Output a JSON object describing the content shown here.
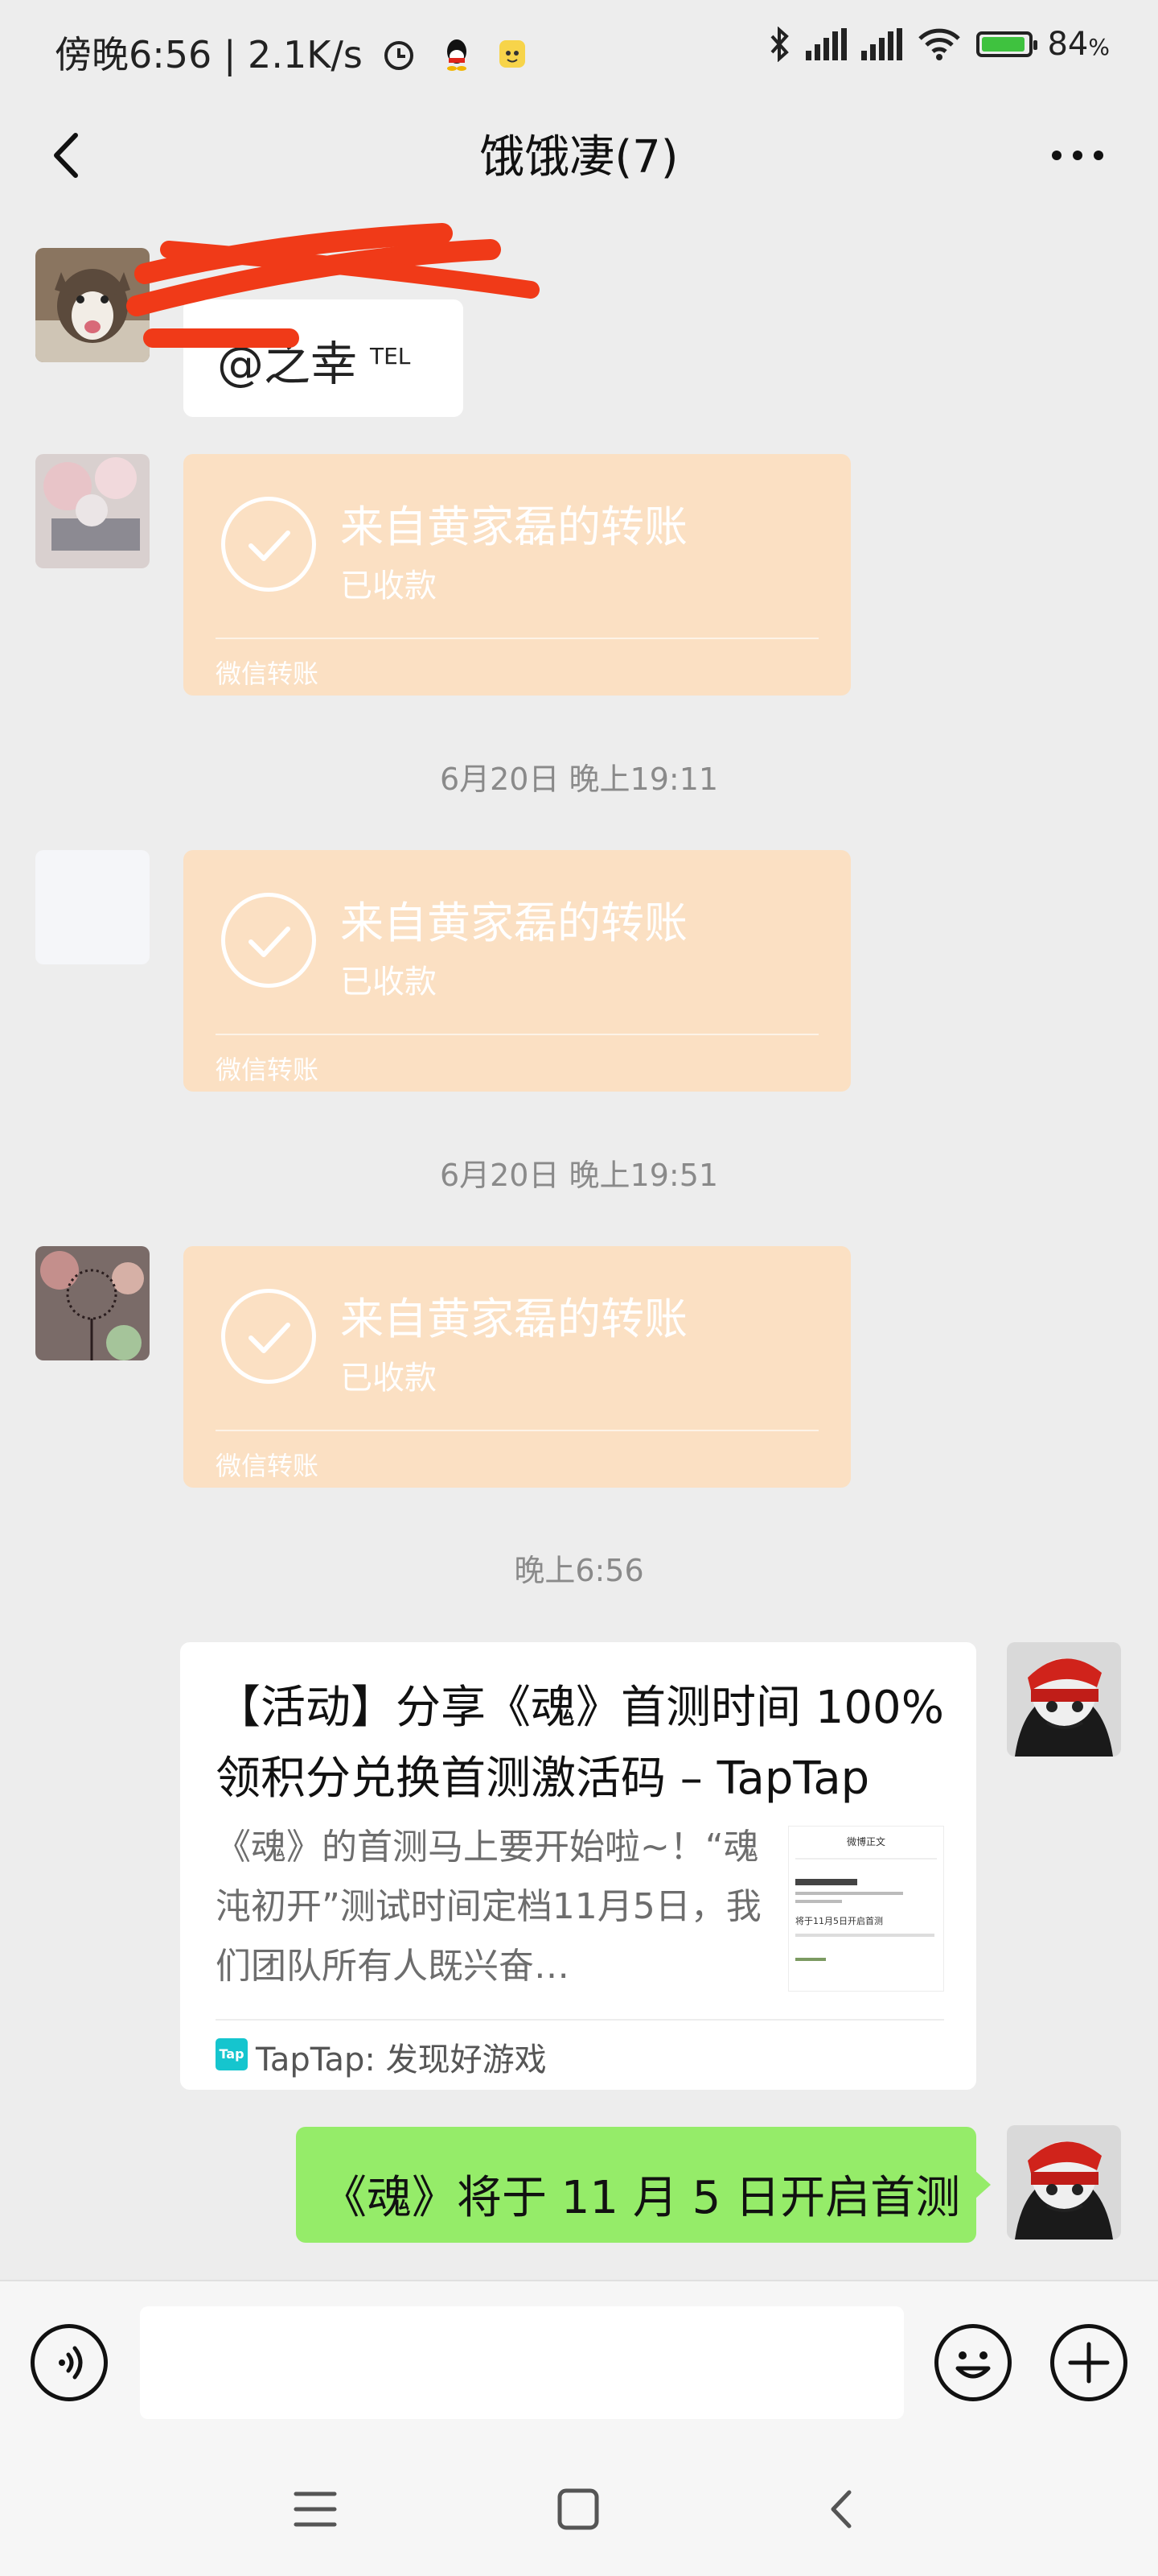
{
  "status_bar": {
    "time": "傍晚6:56",
    "speed": "| 2.1K/s",
    "battery": "84",
    "battery_unit": "%",
    "battery_level": 0.84
  },
  "header": {
    "title": "饿饿凄(7)"
  },
  "messages": {
    "mention": {
      "text": "@之幸",
      "tag": "TEL"
    },
    "transfers": [
      {
        "title": "来自黄家磊的转账",
        "status": "已收款",
        "footer": "微信转账"
      },
      {
        "title": "来自黄家磊的转账",
        "status": "已收款",
        "footer": "微信转账"
      },
      {
        "title": "来自黄家磊的转账",
        "status": "已收款",
        "footer": "微信转账"
      }
    ],
    "timestamps": [
      "6月20日 晚上19:11",
      "6月20日 晚上19:51",
      "晚上6:56"
    ],
    "link_card": {
      "title": "【活动】分享《魂》首测时间 100%领积分兑换首测激活码 – TapTap",
      "description": "《魂》的首测马上要开始啦~！“魂沌初开”测试时间定档11月5日，我们团队所有人既兴奋…",
      "thumb_title": "微博正文",
      "thumb_text": "将于11月5日开启首测",
      "source_icon": "Tap",
      "source": "TapTap: 发现好游戏"
    },
    "outgoing_text": "《魂》将于 11 月 5 日开启首测"
  },
  "input_bar": {
    "placeholder": ""
  },
  "colors": {
    "background": "#ededed",
    "transfer_bubble": "#fbe0c3",
    "outgoing_bubble": "#95ec69",
    "redaction": "#f03a18",
    "taptap_brand": "#15c5ce"
  }
}
